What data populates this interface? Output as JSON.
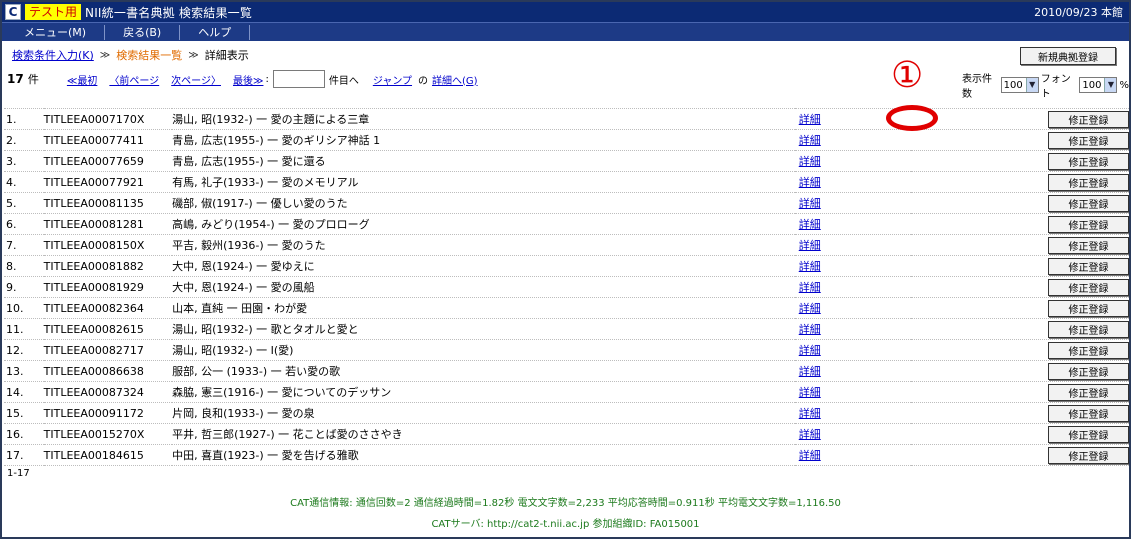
{
  "window": {
    "icon_letter": "C",
    "test_badge": "テスト用",
    "title": "NII統一書名典拠 検索結果一覧",
    "date": "2010/09/23 本館"
  },
  "menu": [
    "メニュー(M)",
    "戻る(B)",
    "ヘルプ"
  ],
  "breadcrumb": {
    "search_input": "検索条件入力(K)",
    "result_list": "検索結果一覧",
    "detail": "詳細表示",
    "sep": "≫"
  },
  "new_button": "新規典拠登録",
  "pager": {
    "count": "17",
    "count_unit": "件",
    "first": "≪最初",
    "prev": "〈前ページ",
    "next": "次ページ〉",
    "last": "最後≫",
    "colon": ":",
    "goto_label": "件目へ",
    "jump": "ジャンプ",
    "detail_of": "の",
    "detail_link": "詳細へ(G)"
  },
  "options": {
    "display_count_label": "表示件数",
    "display_count_value": "100",
    "font_label": "フォント",
    "font_value": "100",
    "percent": "%"
  },
  "annotation_number": "①",
  "rows": [
    {
      "no": "1.",
      "id": "TITLEEA0007170X",
      "title": "湯山, 昭(1932-) 一 愛の主題による三章",
      "link": "詳細",
      "btn": "修正登録"
    },
    {
      "no": "2.",
      "id": "TITLEEA00077411",
      "title": "青島, 広志(1955-) 一 愛のギリシア神話 1",
      "link": "詳細",
      "btn": "修正登録"
    },
    {
      "no": "3.",
      "id": "TITLEEA00077659",
      "title": "青島, 広志(1955-) 一 愛に還る",
      "link": "詳細",
      "btn": "修正登録"
    },
    {
      "no": "4.",
      "id": "TITLEEA00077921",
      "title": "有馬, 礼子(1933-) 一 愛のメモリアル",
      "link": "詳細",
      "btn": "修正登録"
    },
    {
      "no": "5.",
      "id": "TITLEEA00081135",
      "title": "磯部, 俶(1917-) 一 優しい愛のうた",
      "link": "詳細",
      "btn": "修正登録"
    },
    {
      "no": "6.",
      "id": "TITLEEA00081281",
      "title": "高嶋, みどり(1954-) 一 愛のプロローグ",
      "link": "詳細",
      "btn": "修正登録"
    },
    {
      "no": "7.",
      "id": "TITLEEA0008150X",
      "title": "平吉, 毅州(1936-) 一 愛のうた",
      "link": "詳細",
      "btn": "修正登録"
    },
    {
      "no": "8.",
      "id": "TITLEEA00081882",
      "title": "大中, 恩(1924-) 一 愛ゆえに",
      "link": "詳細",
      "btn": "修正登録"
    },
    {
      "no": "9.",
      "id": "TITLEEA00081929",
      "title": "大中, 恩(1924-) 一 愛の風船",
      "link": "詳細",
      "btn": "修正登録"
    },
    {
      "no": "10.",
      "id": "TITLEEA00082364",
      "title": "山本, 直純 一 田園・わが愛",
      "link": "詳細",
      "btn": "修正登録"
    },
    {
      "no": "11.",
      "id": "TITLEEA00082615",
      "title": "湯山, 昭(1932-) 一 歌とタオルと愛と",
      "link": "詳細",
      "btn": "修正登録"
    },
    {
      "no": "12.",
      "id": "TITLEEA00082717",
      "title": "湯山, 昭(1932-) 一 I(愛)",
      "link": "詳細",
      "btn": "修正登録"
    },
    {
      "no": "13.",
      "id": "TITLEEA00086638",
      "title": "服部, 公一 (1933-) 一 若い愛の歌",
      "link": "詳細",
      "btn": "修正登録"
    },
    {
      "no": "14.",
      "id": "TITLEEA00087324",
      "title": "森脇, 憲三(1916-) 一 愛についてのデッサン",
      "link": "詳細",
      "btn": "修正登録"
    },
    {
      "no": "15.",
      "id": "TITLEEA00091172",
      "title": "片岡, 良和(1933-) 一 愛の泉",
      "link": "詳細",
      "btn": "修正登録"
    },
    {
      "no": "16.",
      "id": "TITLEEA0015270X",
      "title": "平井, 哲三郎(1927-) 一 花ことば愛のささやき",
      "link": "詳細",
      "btn": "修正登録"
    },
    {
      "no": "17.",
      "id": "TITLEEA00184615",
      "title": "中田, 喜直(1923-) 一 愛を告げる雅歌",
      "link": "詳細",
      "btn": "修正登録"
    }
  ],
  "range_text": "1-17",
  "footer": {
    "line1": "CAT通信情報: 通信回数=2 通信経過時間=1.82秒 電文文字数=2,233 平均応答時間=0.911秒 平均電文文字数=1,116.50",
    "line2": "CATサーバ: http://cat2-t.nii.ac.jp 参加組織ID: FA015001"
  }
}
